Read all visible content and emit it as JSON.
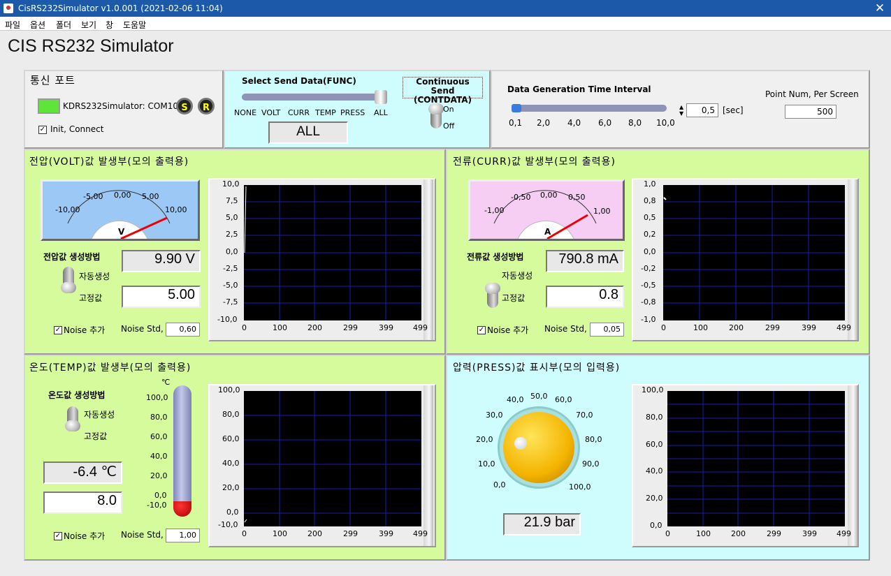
{
  "window": {
    "title": "CisRS232Simulator v1.0.001 (2021-02-06 11:04)",
    "close_icon": "close-icon"
  },
  "menu": [
    "파일",
    "옵션",
    "폴더",
    "보기",
    "창",
    "도움말"
  ],
  "app_title": "CIS RS232 Simulator",
  "comm": {
    "title": "통신 포트",
    "port_label": "KDRS232Simulator: COM10",
    "status_color": "#5fe43a",
    "s_label": "S",
    "r_label": "R",
    "init_label": "Init, Connect",
    "init_checked": true
  },
  "send": {
    "title": "Select Send Data(FUNC)",
    "options": [
      "NONE",
      "VOLT",
      "CURR",
      "TEMP",
      "PRESS",
      "ALL"
    ],
    "value": "ALL",
    "continuous_title": "Continuous Send",
    "continuous_sub": "(CONTDATA)",
    "on_label": "On",
    "off_label": "Off"
  },
  "interval": {
    "title": "Data Generation Time Interval",
    "ticks": [
      "0,1",
      "2,0",
      "4,0",
      "6,0",
      "8,0",
      "10,0"
    ],
    "value": "0,5",
    "unit": "[sec]",
    "points_label": "Point Num, Per Screen",
    "points": "500"
  },
  "volt": {
    "title": "전압(VOLT)값 발생부(모의 출력용)",
    "gauge_ticks": [
      "-10,00",
      "-5,00",
      "0,00",
      "5,00",
      "10,00"
    ],
    "gauge_unit": "V",
    "method_label": "전압값 생성방법",
    "auto_label": "자동생성",
    "fixed_label": "고정값",
    "reading": "9.90 V",
    "fixed": "5.00",
    "noise_label": "Noise 추가",
    "noise_std_label": "Noise Std,",
    "noise_std": "0,60",
    "y_ticks": [
      "10,0",
      "7,5",
      "5,0",
      "2,5",
      "0,0",
      "-2,5",
      "-5,0",
      "-7,5",
      "-10,0"
    ],
    "x_ticks": [
      "0",
      "100",
      "200",
      "299",
      "399",
      "499"
    ]
  },
  "curr": {
    "title": "전류(CURR)값 발생부(모의 출력용)",
    "gauge_ticks": [
      "-1,00",
      "-0,50",
      "0,00",
      "0,50",
      "1,00"
    ],
    "gauge_unit": "A",
    "method_label": "전류값 생성방법",
    "auto_label": "자동생성",
    "fixed_label": "고정값",
    "reading": "790.8 mA",
    "fixed": "0.8",
    "noise_label": "Noise 추가",
    "noise_std_label": "Noise Std,",
    "noise_std": "0,05",
    "y_ticks": [
      "1,0",
      "0,8",
      "0,5",
      "0,2",
      "0,0",
      "-0,2",
      "-0,5",
      "-0,8",
      "-1,0"
    ],
    "x_ticks": [
      "0",
      "100",
      "200",
      "299",
      "399",
      "499"
    ]
  },
  "temp": {
    "title": "온도(TEMP)값 발생부(모의 출력용)",
    "method_label": "온도값 생성방법",
    "auto_label": "자동생성",
    "fixed_label": "고정값",
    "reading": "-6.4 ℃",
    "fixed": "8.0",
    "therm_unit": "℃",
    "therm_ticks": [
      "100,0",
      "80,0",
      "60,0",
      "40,0",
      "20,0",
      "0,0",
      "-10,0"
    ],
    "noise_label": "Noise 추가",
    "noise_std_label": "Noise Std,",
    "noise_std": "1,00",
    "y_ticks": [
      "100,0",
      "80,0",
      "60,0",
      "40,0",
      "20,0",
      "0,0",
      "-10,0"
    ],
    "x_ticks": [
      "0",
      "100",
      "200",
      "299",
      "399",
      "499"
    ]
  },
  "press": {
    "title": "압력(PRESS)값 표시부(모의 입력용)",
    "knob_ticks": [
      "0,0",
      "10,0",
      "20,0",
      "30,0",
      "40,0",
      "50,0",
      "60,0",
      "70,0",
      "80,0",
      "90,0",
      "100,0"
    ],
    "reading": "21.9 bar",
    "y_ticks": [
      "100,0",
      "80,0",
      "60,0",
      "40,0",
      "20,0",
      "0,0"
    ],
    "x_ticks": [
      "0",
      "100",
      "200",
      "299",
      "399",
      "499"
    ]
  }
}
